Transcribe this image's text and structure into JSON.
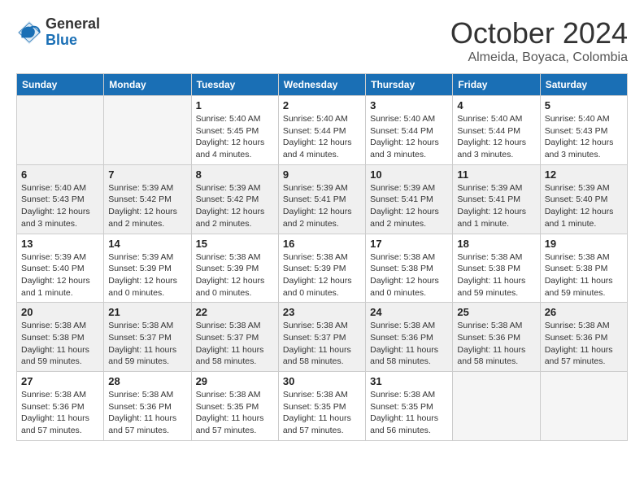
{
  "logo": {
    "line1": "General",
    "line2": "Blue"
  },
  "title": "October 2024",
  "subtitle": "Almeida, Boyaca, Colombia",
  "days_of_week": [
    "Sunday",
    "Monday",
    "Tuesday",
    "Wednesday",
    "Thursday",
    "Friday",
    "Saturday"
  ],
  "weeks": [
    [
      {
        "day": "",
        "info": ""
      },
      {
        "day": "",
        "info": ""
      },
      {
        "day": "1",
        "info": "Sunrise: 5:40 AM\nSunset: 5:45 PM\nDaylight: 12 hours and 4 minutes."
      },
      {
        "day": "2",
        "info": "Sunrise: 5:40 AM\nSunset: 5:44 PM\nDaylight: 12 hours and 4 minutes."
      },
      {
        "day": "3",
        "info": "Sunrise: 5:40 AM\nSunset: 5:44 PM\nDaylight: 12 hours and 3 minutes."
      },
      {
        "day": "4",
        "info": "Sunrise: 5:40 AM\nSunset: 5:44 PM\nDaylight: 12 hours and 3 minutes."
      },
      {
        "day": "5",
        "info": "Sunrise: 5:40 AM\nSunset: 5:43 PM\nDaylight: 12 hours and 3 minutes."
      }
    ],
    [
      {
        "day": "6",
        "info": "Sunrise: 5:40 AM\nSunset: 5:43 PM\nDaylight: 12 hours and 3 minutes."
      },
      {
        "day": "7",
        "info": "Sunrise: 5:39 AM\nSunset: 5:42 PM\nDaylight: 12 hours and 2 minutes."
      },
      {
        "day": "8",
        "info": "Sunrise: 5:39 AM\nSunset: 5:42 PM\nDaylight: 12 hours and 2 minutes."
      },
      {
        "day": "9",
        "info": "Sunrise: 5:39 AM\nSunset: 5:41 PM\nDaylight: 12 hours and 2 minutes."
      },
      {
        "day": "10",
        "info": "Sunrise: 5:39 AM\nSunset: 5:41 PM\nDaylight: 12 hours and 2 minutes."
      },
      {
        "day": "11",
        "info": "Sunrise: 5:39 AM\nSunset: 5:41 PM\nDaylight: 12 hours and 1 minute."
      },
      {
        "day": "12",
        "info": "Sunrise: 5:39 AM\nSunset: 5:40 PM\nDaylight: 12 hours and 1 minute."
      }
    ],
    [
      {
        "day": "13",
        "info": "Sunrise: 5:39 AM\nSunset: 5:40 PM\nDaylight: 12 hours and 1 minute."
      },
      {
        "day": "14",
        "info": "Sunrise: 5:39 AM\nSunset: 5:39 PM\nDaylight: 12 hours and 0 minutes."
      },
      {
        "day": "15",
        "info": "Sunrise: 5:38 AM\nSunset: 5:39 PM\nDaylight: 12 hours and 0 minutes."
      },
      {
        "day": "16",
        "info": "Sunrise: 5:38 AM\nSunset: 5:39 PM\nDaylight: 12 hours and 0 minutes."
      },
      {
        "day": "17",
        "info": "Sunrise: 5:38 AM\nSunset: 5:38 PM\nDaylight: 12 hours and 0 minutes."
      },
      {
        "day": "18",
        "info": "Sunrise: 5:38 AM\nSunset: 5:38 PM\nDaylight: 11 hours and 59 minutes."
      },
      {
        "day": "19",
        "info": "Sunrise: 5:38 AM\nSunset: 5:38 PM\nDaylight: 11 hours and 59 minutes."
      }
    ],
    [
      {
        "day": "20",
        "info": "Sunrise: 5:38 AM\nSunset: 5:38 PM\nDaylight: 11 hours and 59 minutes."
      },
      {
        "day": "21",
        "info": "Sunrise: 5:38 AM\nSunset: 5:37 PM\nDaylight: 11 hours and 59 minutes."
      },
      {
        "day": "22",
        "info": "Sunrise: 5:38 AM\nSunset: 5:37 PM\nDaylight: 11 hours and 58 minutes."
      },
      {
        "day": "23",
        "info": "Sunrise: 5:38 AM\nSunset: 5:37 PM\nDaylight: 11 hours and 58 minutes."
      },
      {
        "day": "24",
        "info": "Sunrise: 5:38 AM\nSunset: 5:36 PM\nDaylight: 11 hours and 58 minutes."
      },
      {
        "day": "25",
        "info": "Sunrise: 5:38 AM\nSunset: 5:36 PM\nDaylight: 11 hours and 58 minutes."
      },
      {
        "day": "26",
        "info": "Sunrise: 5:38 AM\nSunset: 5:36 PM\nDaylight: 11 hours and 57 minutes."
      }
    ],
    [
      {
        "day": "27",
        "info": "Sunrise: 5:38 AM\nSunset: 5:36 PM\nDaylight: 11 hours and 57 minutes."
      },
      {
        "day": "28",
        "info": "Sunrise: 5:38 AM\nSunset: 5:36 PM\nDaylight: 11 hours and 57 minutes."
      },
      {
        "day": "29",
        "info": "Sunrise: 5:38 AM\nSunset: 5:35 PM\nDaylight: 11 hours and 57 minutes."
      },
      {
        "day": "30",
        "info": "Sunrise: 5:38 AM\nSunset: 5:35 PM\nDaylight: 11 hours and 57 minutes."
      },
      {
        "day": "31",
        "info": "Sunrise: 5:38 AM\nSunset: 5:35 PM\nDaylight: 11 hours and 56 minutes."
      },
      {
        "day": "",
        "info": ""
      },
      {
        "day": "",
        "info": ""
      }
    ]
  ]
}
